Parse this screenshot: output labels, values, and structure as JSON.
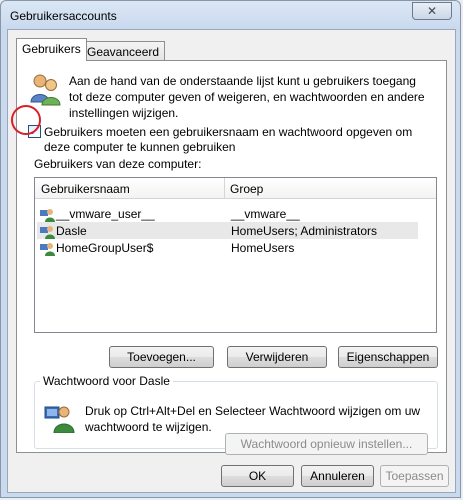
{
  "window": {
    "title": "Gebruikersaccounts",
    "close_symbol": "✕"
  },
  "tabs": [
    {
      "label": "Gebruikers",
      "active": true
    },
    {
      "label": "Geavanceerd",
      "active": false
    }
  ],
  "intro_text": "Aan de hand van de onderstaande lijst kunt u gebruikers toegang tot deze computer geven of weigeren, en wachtwoorden en andere instellingen wijzigen.",
  "require_login": {
    "checked": true,
    "check_mark": "✓",
    "label": "Gebruikers moeten een gebruikersnaam en wachtwoord opgeven om deze computer te kunnen gebruiken"
  },
  "users_heading": "Gebruikers van deze computer:",
  "user_list": {
    "columns": [
      "Gebruikersnaam",
      "Groep"
    ],
    "rows": [
      {
        "name": "__vmware_user__",
        "group": "__vmware__",
        "selected": false
      },
      {
        "name": "Dasle",
        "group": "HomeUsers; Administrators",
        "selected": true
      },
      {
        "name": "HomeGroupUser$",
        "group": "HomeUsers",
        "selected": false
      }
    ]
  },
  "buttons": {
    "add": "Toevoegen...",
    "remove": "Verwijderen",
    "properties": "Eigenschappen",
    "ok": "OK",
    "cancel": "Annuleren",
    "apply": "Toepassen"
  },
  "password_group": {
    "legend": "Wachtwoord voor Dasle",
    "text": "Druk op Ctrl+Alt+Del en Selecteer Wachtwoord wijzigen om uw wachtwoord te wijzigen.",
    "reset_button": "Wachtwoord opnieuw instellen..."
  },
  "colors": {
    "accent": "#1c5180",
    "annotation_circle": "#d8202a",
    "selected_row": "#e8e8e8"
  }
}
